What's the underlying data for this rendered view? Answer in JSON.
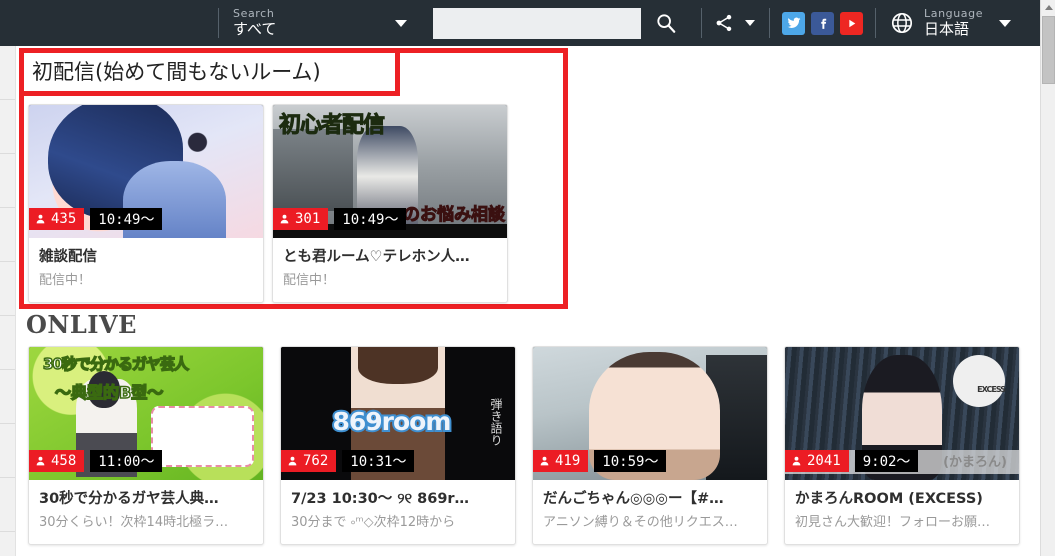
{
  "header": {
    "search_filter": {
      "label": "Search",
      "value": "すべて",
      "icon": "chevron-down-icon"
    },
    "search_input": {
      "value": "",
      "placeholder": ""
    },
    "search_button_icon": "search-icon",
    "share_button": {
      "icon": "share-icon",
      "caret_icon": "chevron-down-icon"
    },
    "social": [
      {
        "name": "twitter",
        "glyph": "t",
        "color": "#4da7e8"
      },
      {
        "name": "facebook",
        "glyph": "f",
        "color": "#3b5998"
      },
      {
        "name": "youtube",
        "glyph": "▶",
        "color": "#ee2722"
      }
    ],
    "language": {
      "icon": "globe-icon",
      "label": "Language",
      "value": "日本語",
      "caret_icon": "chevron-down-icon"
    }
  },
  "highlight_box": {
    "color": "#ed2024"
  },
  "sections": [
    {
      "id": "first-broadcast",
      "title": "初配信(始めて間もないルーム)",
      "cards": [
        {
          "viewers": "435",
          "time": "10:49〜",
          "title": "雑談配信",
          "subtitle": "配信中！",
          "thumb_overlay_top": "",
          "thumb_overlay_bottom": ""
        },
        {
          "viewers": "301",
          "time": "10:49〜",
          "title": "とも君ルーム♡テレホン人…",
          "subtitle": "配信中！",
          "thumb_overlay_top": "初心者配信",
          "thumb_overlay_bottom": "のお悩み相談"
        }
      ]
    },
    {
      "id": "onlive",
      "title": "ONLIVE",
      "cards": [
        {
          "viewers": "458",
          "time": "11:00〜",
          "title": "30秒で分かるガヤ芸人典…",
          "subtitle": "30分くらい！次枠14時北極ラ…",
          "thumb_overlay_top": "30秒で分かるガヤ芸人",
          "thumb_overlay_bottom": "〜典型的B型〜"
        },
        {
          "viewers": "762",
          "time": "10:31〜",
          "title": "7/23 10:30〜 ୨୧ 869r…",
          "subtitle": "30分まで ༚ᵐ◇次枠12時から",
          "thumb_overlay_top": "869room",
          "thumb_overlay_bottom": "弾き語り"
        },
        {
          "viewers": "419",
          "time": "10:59〜",
          "title": "だんごちゃん◎◎◎ー【#…",
          "subtitle": "アニソン縛り＆その他リクエス…",
          "thumb_overlay_top": "",
          "thumb_overlay_bottom": ""
        },
        {
          "viewers": "2041",
          "time": "9:02〜",
          "title": "かまろんROOM (EXCESS)",
          "subtitle": "初見さん大歓迎！フォローお願…",
          "thumb_overlay_top": "EXCESS",
          "thumb_overlay_bottom": "(かまろん)"
        }
      ]
    }
  ],
  "colors": {
    "header_bg": "#262f36",
    "accent_red": "#ec1c24",
    "badge_time_bg": "#000000",
    "card_title": "#2f2f2f",
    "card_subtitle": "#9a9a9a"
  },
  "scrollbar": {
    "up_arrow_icon": "triangle-up-icon"
  }
}
